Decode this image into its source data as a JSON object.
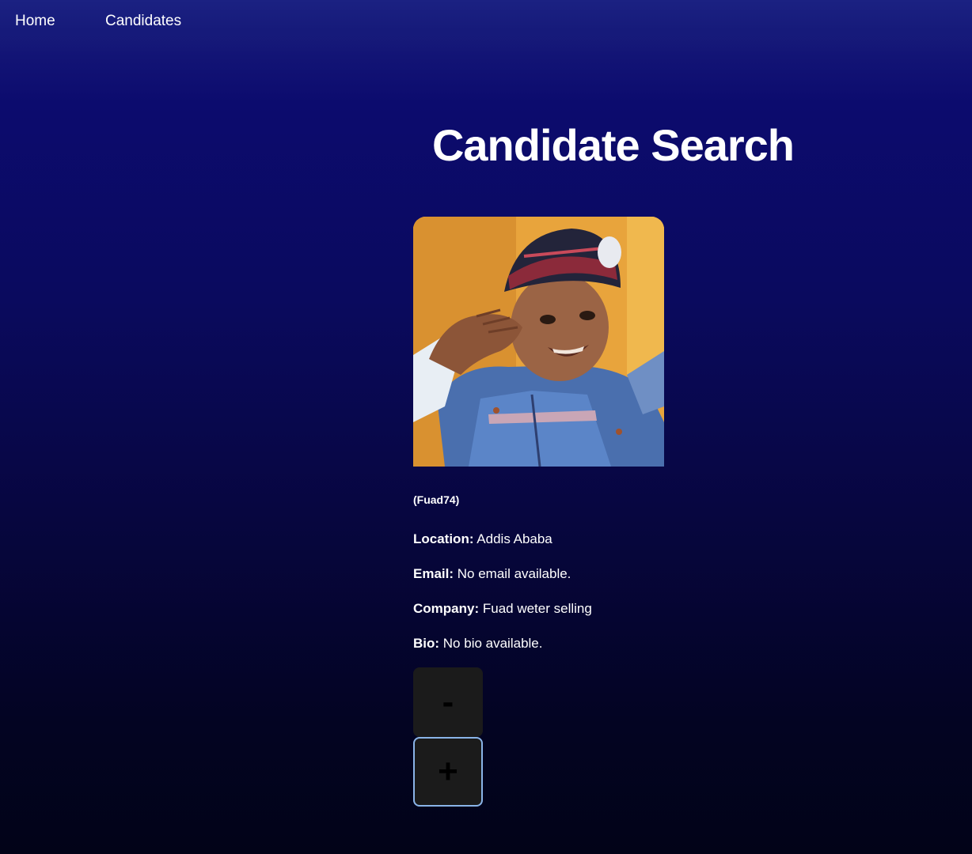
{
  "nav": {
    "items": [
      {
        "label": "Home"
      },
      {
        "label": "Candidates"
      }
    ]
  },
  "main": {
    "title": "Candidate Search"
  },
  "candidate": {
    "username": "(Fuad74)",
    "location_label": "Location:",
    "location": "Addis Ababa",
    "email_label": "Email:",
    "email": "No email available.",
    "company_label": "Company:",
    "company": "Fuad weter selling",
    "bio_label": "Bio:",
    "bio": "No bio available."
  },
  "actions": {
    "reject_label": "-",
    "accept_label": "+"
  }
}
